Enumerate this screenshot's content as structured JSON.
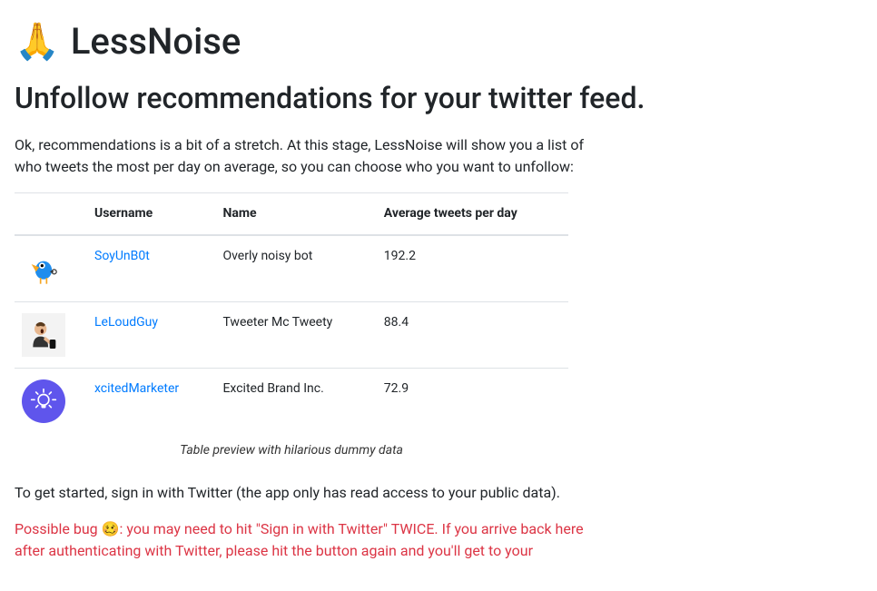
{
  "header": {
    "emoji": "🙏",
    "title": "LessNoise"
  },
  "subtitle": "Unfollow recommendations for your twitter feed.",
  "intro": "Ok, recommendations is a bit of a stretch. At this stage, LessNoise will show you a list of who tweets the most per day on average, so you can choose who you want to unfollow:",
  "table": {
    "headers": {
      "col_avatar": "",
      "col_username": "Username",
      "col_name": "Name",
      "col_avg": "Average tweets per day"
    },
    "rows": [
      {
        "avatar": "bird",
        "username": "SoyUnB0t",
        "name": "Overly noisy bot",
        "avg": "192.2"
      },
      {
        "avatar": "man",
        "username": "LeLoudGuy",
        "name": "Tweeter Mc Tweety",
        "avg": "88.4"
      },
      {
        "avatar": "bulb",
        "username": "xcitedMarketer",
        "name": "Excited Brand Inc.",
        "avg": "72.9"
      }
    ],
    "caption": "Table preview with hilarious dummy data"
  },
  "get_started": "To get started, sign in with Twitter (the app only has read access to your public data).",
  "bug_note": "Possible bug 🥴: you may need to hit \"Sign in with Twitter\" TWICE. If you arrive back here after authenticating with Twitter, please hit the button again and you'll get to your"
}
